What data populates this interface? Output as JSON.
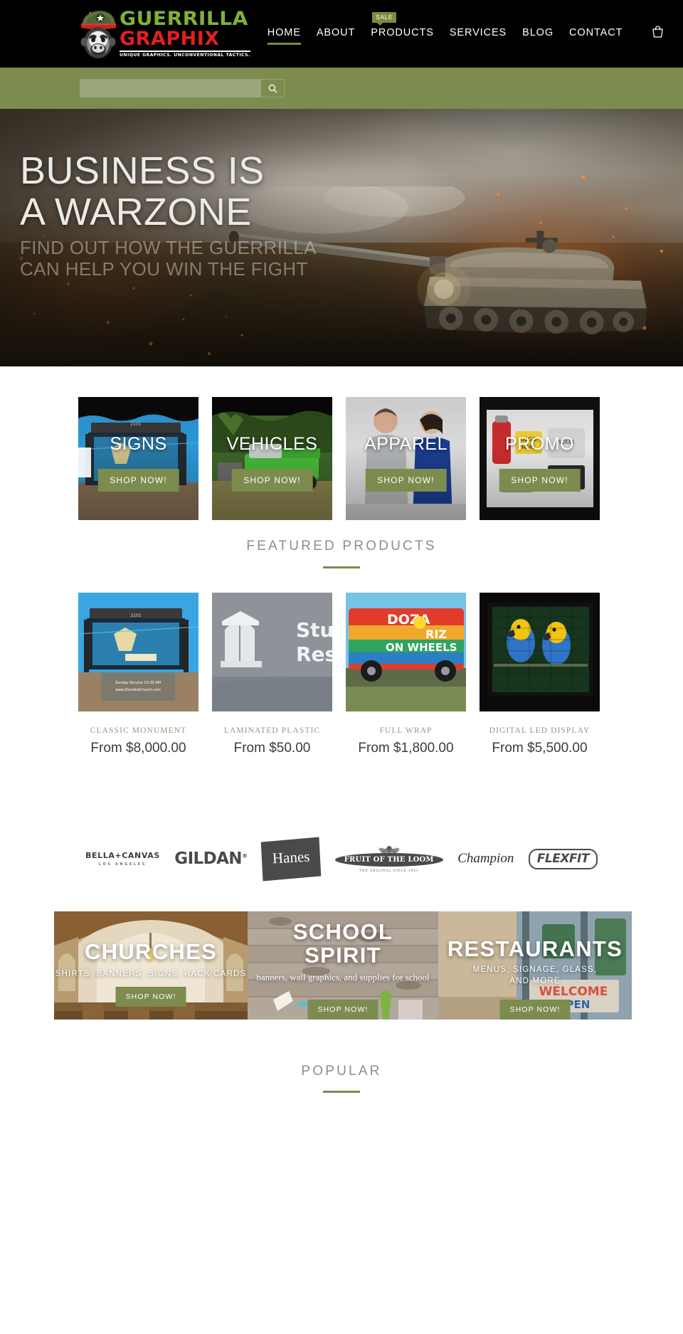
{
  "brand": {
    "logo_line1": "GUERRILLA",
    "logo_line2": "GRAPHIX",
    "logo_tagline": "UNIQUE GRAPHICS.  UNCONVENTIONAL TACTICS.",
    "logo_icon": "gorilla-helmet-logo",
    "accent_green": "#7b8c4e",
    "logo_green": "#7fb239",
    "logo_red": "#e02020"
  },
  "nav": {
    "items": [
      {
        "label": "HOME",
        "active": true,
        "badge": ""
      },
      {
        "label": "ABOUT",
        "active": false,
        "badge": ""
      },
      {
        "label": "PRODUCTS",
        "active": false,
        "badge": "SALE"
      },
      {
        "label": "SERVICES",
        "active": false,
        "badge": ""
      },
      {
        "label": "BLOG",
        "active": false,
        "badge": ""
      },
      {
        "label": "CONTACT",
        "active": false,
        "badge": ""
      }
    ],
    "cart_icon": "shopping-cart-icon",
    "cart_glyph": "🛒"
  },
  "search": {
    "value": "",
    "placeholder": "",
    "button_icon": "search-icon",
    "button_glyph": "🔍"
  },
  "hero": {
    "title_line1": "BUSINESS IS",
    "title_line2": "A WARZONE",
    "subtitle_line1": "FIND OUT HOW THE GUERRILLA",
    "subtitle_line2": "CAN HELP YOU WIN THE FIGHT",
    "image_alt": "tank-battlefield-photo"
  },
  "categories": {
    "prev_arrow_icon": "chevron-left-icon",
    "items": [
      {
        "title": "SIGNS",
        "button": "SHOP NOW!",
        "image_alt": "church-monument-sign-photo"
      },
      {
        "title": "VEHICLES",
        "button": "SHOP NOW!",
        "image_alt": "green-wrapped-truck-photo"
      },
      {
        "title": "APPAREL",
        "button": "SHOP NOW!",
        "image_alt": "man-and-woman-apparel-photo"
      },
      {
        "title": "PROMO",
        "button": "SHOP NOW!",
        "image_alt": "promotional-products-photo"
      }
    ]
  },
  "featured": {
    "heading": "FEATURED PRODUCTS",
    "products": [
      {
        "name": "CLASSIC MONUMENT",
        "price": "From $8,000.00",
        "image_alt": "decided-church-monument-sign-photo"
      },
      {
        "name": "LAMINATED PLASTIC",
        "price": "From $50.00",
        "image_alt": "student-resource-dimensional-letters-photo"
      },
      {
        "name": "FULL WRAP",
        "price": "From $1,800.00",
        "image_alt": "doza-riz-food-truck-wrap-photo"
      },
      {
        "name": "DIGITAL LED DISPLAY",
        "price": "From $5,500.00",
        "image_alt": "led-display-parrots-photo"
      }
    ]
  },
  "brands": {
    "items": [
      {
        "name": "BELLA+CANVAS",
        "sub": "LOS ANGELES",
        "style": "bella"
      },
      {
        "name": "GILDAN",
        "sub": "®",
        "style": "gildan"
      },
      {
        "name": "Hanes",
        "sub": "",
        "style": "hanes"
      },
      {
        "name": "FRUIT OF THE LOOM",
        "sub": "THE ORIGINAL SINCE 1851",
        "style": "fotl"
      },
      {
        "name": "Champion",
        "sub": "",
        "style": "champion"
      },
      {
        "name": "FLEXFIT",
        "sub": "",
        "style": "flexfit"
      }
    ]
  },
  "industry_banners": [
    {
      "title": "CHURCHES",
      "subtitle": "SHIRTS, BANNERS, SIGNS, RACK CARDS",
      "button": "SHOP NOW!",
      "image_alt": "church-interior-photo",
      "subtitle_style": "caps"
    },
    {
      "title_line1": "SCHOOL",
      "title_line2": "SPIRIT",
      "subtitle": "banners, wall graphics, and supplies for school",
      "button": "SHOP NOW!",
      "image_alt": "school-supplies-wood-photo",
      "subtitle_style": "serif"
    },
    {
      "title": "RESTAURANTS",
      "subtitle_line1": "MENUS, SIGNAGE, GLASS,",
      "subtitle_line2": "AND MORE",
      "button": "SHOP NOW!",
      "image_alt": "restaurant-open-sign-photo",
      "subtitle_style": "caps"
    }
  ],
  "popular": {
    "heading": "POPULAR"
  }
}
